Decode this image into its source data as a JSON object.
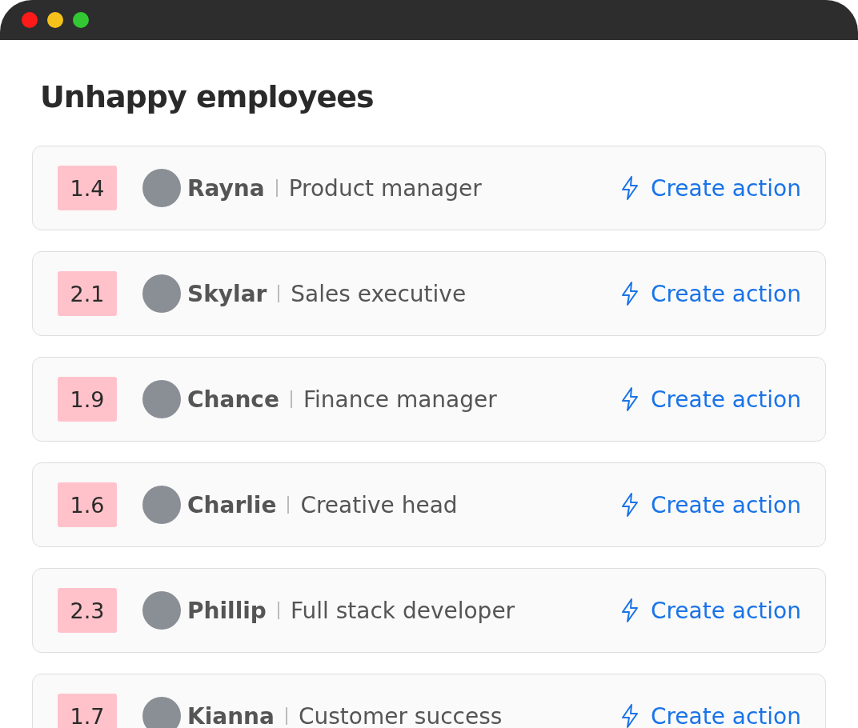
{
  "heading": "Unhappy employees",
  "employees": [
    {
      "score": "1.4",
      "name": "Rayna",
      "role": "Product manager",
      "action": "Create action"
    },
    {
      "score": "2.1",
      "name": "Skylar",
      "role": "Sales executive",
      "action": "Create action"
    },
    {
      "score": "1.9",
      "name": "Chance",
      "role": "Finance manager",
      "action": "Create action"
    },
    {
      "score": "1.6",
      "name": "Charlie",
      "role": "Creative head",
      "action": "Create action"
    },
    {
      "score": "2.3",
      "name": "Phillip",
      "role": "Full stack developer",
      "action": "Create action"
    },
    {
      "score": "1.7",
      "name": "Kianna",
      "role": "Customer success",
      "action": "Create action"
    }
  ]
}
